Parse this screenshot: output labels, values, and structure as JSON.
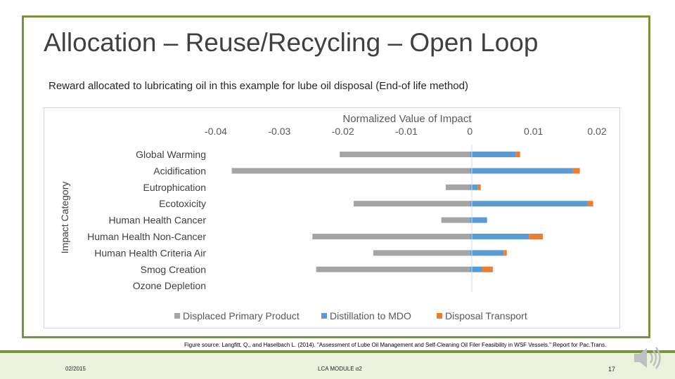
{
  "slide": {
    "title": "Allocation – Reuse/Recycling – Open Loop",
    "subtitle": "Reward allocated to lubricating oil in this example for lube oil disposal (End-of life method)",
    "source": "Figure source: Langfitt, Q., and Haselbach L. (2014). \"Assessment of Lube Oil Management and Self-Cleaning Oil Filer Feasibility in WSF Vessels.\" Report for Pac.Trans.",
    "footer": {
      "date": "02/2015",
      "center": "LCA MODULE α2",
      "page": "17"
    },
    "icons": {
      "speaker": "speaker-icon"
    },
    "colors": {
      "accent": "#77933c",
      "footer_bg": "#eaf1dd"
    }
  },
  "chart_data": {
    "type": "bar",
    "orientation": "horizontal",
    "stacked": true,
    "title": "Normalized Value of Impact",
    "ylabel": "Impact Category",
    "xlim": [
      -0.04,
      0.02
    ],
    "xticks": [
      "-0.04",
      "-0.03",
      "-0.02",
      "-0.01",
      "0",
      "0.01",
      "0.02"
    ],
    "tick_values": [
      -0.04,
      -0.03,
      -0.02,
      -0.01,
      0,
      0.01,
      0.02
    ],
    "x_axis_position": "top",
    "grid": false,
    "legend_position": "bottom",
    "categories": [
      "Global Warming",
      "Acidification",
      "Eutrophication",
      "Ecotoxicity",
      "Human Health Cancer",
      "Human Health Non-Cancer",
      "Human Health Criteria Air",
      "Smog Creation",
      "Ozone Depletion"
    ],
    "series": [
      {
        "name": "Displaced Primary Product",
        "color": "#a5a5a5",
        "values": [
          -0.0205,
          -0.0375,
          -0.0038,
          -0.0183,
          -0.0045,
          -0.0248,
          -0.0152,
          -0.0242,
          0
        ]
      },
      {
        "name": "Distillation to MDO",
        "color": "#5b9bd5",
        "values": [
          0.0072,
          0.0162,
          0.0012,
          0.0185,
          0.0027,
          0.0093,
          0.0053,
          0.0019,
          0
        ]
      },
      {
        "name": "Disposal Transport",
        "color": "#ed7d31",
        "values": [
          0.0007,
          0.0011,
          0.0005,
          0.0009,
          0,
          0.0022,
          0.0005,
          0.0017,
          0
        ]
      }
    ]
  }
}
